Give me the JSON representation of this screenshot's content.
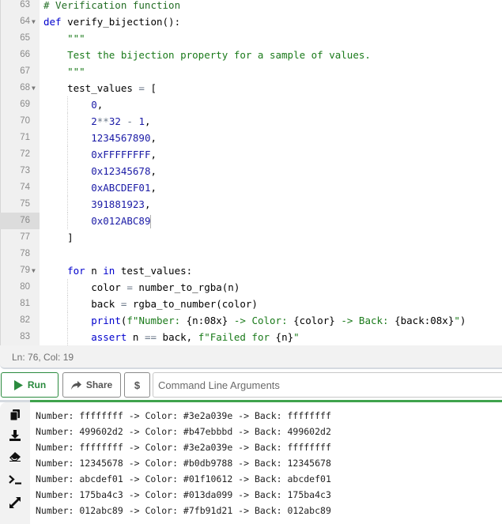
{
  "editor": {
    "lines": [
      {
        "num": "63",
        "fold": false,
        "tokens": [
          {
            "t": "# Verification function",
            "c": "comment"
          }
        ]
      },
      {
        "num": "64",
        "fold": true,
        "tokens": [
          {
            "t": "def",
            "c": "kw"
          },
          {
            "t": " verify_bijection():",
            "c": "fn"
          }
        ]
      },
      {
        "num": "65",
        "fold": false,
        "tokens": [
          {
            "t": "    \"\"\"",
            "c": "str"
          }
        ]
      },
      {
        "num": "66",
        "fold": false,
        "tokens": [
          {
            "t": "    Test the bijection property for a sample of values.",
            "c": "str"
          }
        ]
      },
      {
        "num": "67",
        "fold": false,
        "tokens": [
          {
            "t": "    \"\"\"",
            "c": "str"
          }
        ]
      },
      {
        "num": "68",
        "fold": true,
        "tokens": [
          {
            "t": "    test_values ",
            "c": "fn"
          },
          {
            "t": "=",
            "c": "op"
          },
          {
            "t": " [",
            "c": "fn"
          }
        ]
      },
      {
        "num": "69",
        "fold": false,
        "tokens": [
          {
            "t": "        ",
            "c": "fn"
          },
          {
            "t": "0",
            "c": "num"
          },
          {
            "t": ",",
            "c": "fn"
          }
        ]
      },
      {
        "num": "70",
        "fold": false,
        "tokens": [
          {
            "t": "        ",
            "c": "fn"
          },
          {
            "t": "2",
            "c": "num"
          },
          {
            "t": "**",
            "c": "op"
          },
          {
            "t": "32",
            "c": "num"
          },
          {
            "t": " - ",
            "c": "op"
          },
          {
            "t": "1",
            "c": "num"
          },
          {
            "t": ",",
            "c": "fn"
          }
        ]
      },
      {
        "num": "71",
        "fold": false,
        "tokens": [
          {
            "t": "        ",
            "c": "fn"
          },
          {
            "t": "1234567890",
            "c": "num"
          },
          {
            "t": ",",
            "c": "fn"
          }
        ]
      },
      {
        "num": "72",
        "fold": false,
        "tokens": [
          {
            "t": "        ",
            "c": "fn"
          },
          {
            "t": "0xFFFFFFFF",
            "c": "num"
          },
          {
            "t": ",",
            "c": "fn"
          }
        ]
      },
      {
        "num": "73",
        "fold": false,
        "tokens": [
          {
            "t": "        ",
            "c": "fn"
          },
          {
            "t": "0x12345678",
            "c": "num"
          },
          {
            "t": ",",
            "c": "fn"
          }
        ]
      },
      {
        "num": "74",
        "fold": false,
        "tokens": [
          {
            "t": "        ",
            "c": "fn"
          },
          {
            "t": "0xABCDEF01",
            "c": "num"
          },
          {
            "t": ",",
            "c": "fn"
          }
        ]
      },
      {
        "num": "75",
        "fold": false,
        "tokens": [
          {
            "t": "        ",
            "c": "fn"
          },
          {
            "t": "391881923",
            "c": "num"
          },
          {
            "t": ",",
            "c": "fn"
          }
        ]
      },
      {
        "num": "76",
        "fold": false,
        "active": true,
        "tokens": [
          {
            "t": "        ",
            "c": "fn"
          },
          {
            "t": "0x012ABC89",
            "c": "num"
          }
        ]
      },
      {
        "num": "77",
        "fold": false,
        "tokens": [
          {
            "t": "    ]",
            "c": "fn"
          }
        ]
      },
      {
        "num": "78",
        "fold": false,
        "tokens": []
      },
      {
        "num": "79",
        "fold": true,
        "tokens": [
          {
            "t": "    ",
            "c": "fn"
          },
          {
            "t": "for",
            "c": "kw"
          },
          {
            "t": " n ",
            "c": "fn"
          },
          {
            "t": "in",
            "c": "kw"
          },
          {
            "t": " test_values:",
            "c": "fn"
          }
        ]
      },
      {
        "num": "80",
        "fold": false,
        "tokens": [
          {
            "t": "        color ",
            "c": "fn"
          },
          {
            "t": "=",
            "c": "op"
          },
          {
            "t": " number_to_rgba(n)",
            "c": "fn"
          }
        ]
      },
      {
        "num": "81",
        "fold": false,
        "tokens": [
          {
            "t": "        back ",
            "c": "fn"
          },
          {
            "t": "=",
            "c": "op"
          },
          {
            "t": " rgba_to_number(color)",
            "c": "fn"
          }
        ]
      },
      {
        "num": "82",
        "fold": false,
        "tokens": [
          {
            "t": "        ",
            "c": "fn"
          },
          {
            "t": "print",
            "c": "kw"
          },
          {
            "t": "(",
            "c": "fn"
          },
          {
            "t": "f\"Number: ",
            "c": "str"
          },
          {
            "t": "{n:08x}",
            "c": "fn"
          },
          {
            "t": " -> Color: ",
            "c": "str"
          },
          {
            "t": "{color}",
            "c": "fn"
          },
          {
            "t": " -> Back: ",
            "c": "str"
          },
          {
            "t": "{back:08x}",
            "c": "fn"
          },
          {
            "t": "\"",
            "c": "str"
          },
          {
            "t": ")",
            "c": "fn"
          }
        ]
      },
      {
        "num": "83",
        "fold": false,
        "tokens": [
          {
            "t": "        ",
            "c": "fn"
          },
          {
            "t": "assert",
            "c": "kw"
          },
          {
            "t": " n ",
            "c": "fn"
          },
          {
            "t": "==",
            "c": "op"
          },
          {
            "t": " back, ",
            "c": "fn"
          },
          {
            "t": "f\"Failed for ",
            "c": "str"
          },
          {
            "t": "{n}",
            "c": "fn"
          },
          {
            "t": "\"",
            "c": "str"
          }
        ]
      }
    ]
  },
  "status": {
    "position": "Ln: 76,  Col: 19"
  },
  "toolbar": {
    "run_label": "Run",
    "share_label": "Share",
    "dollar_label": "$",
    "cmd_placeholder": "Command Line Arguments"
  },
  "output": {
    "tools": [
      "copy-icon",
      "download-icon",
      "eraser-icon",
      "terminal-icon",
      "expand-icon"
    ],
    "lines": [
      "Number: ffffffff -> Color: #3e2a039e -> Back: ffffffff",
      "Number: 499602d2 -> Color: #b47ebbbd -> Back: 499602d2",
      "Number: ffffffff -> Color: #3e2a039e -> Back: ffffffff",
      "Number: 12345678 -> Color: #b0db9788 -> Back: 12345678",
      "Number: abcdef01 -> Color: #01f10612 -> Back: abcdef01",
      "Number: 175ba4c3 -> Color: #013da099 -> Back: 175ba4c3",
      "Number: 012abc89 -> Color: #7fb91d21 -> Back: 012abc89"
    ]
  },
  "colors": {
    "run_green": "#2a8a3e",
    "output_border_green": "#3fa34d"
  }
}
